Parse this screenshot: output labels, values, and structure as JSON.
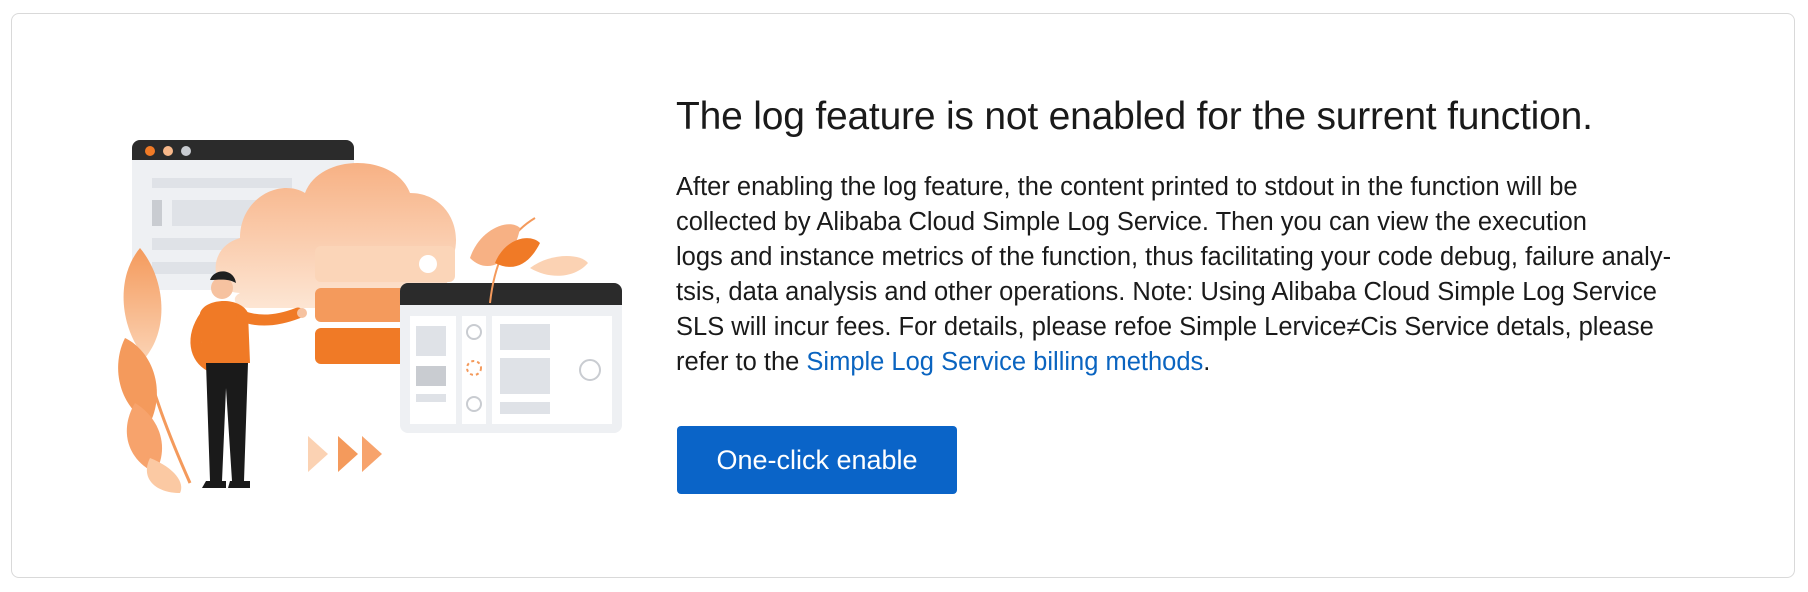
{
  "panel": {
    "title": "The log feature is not enabled for the surrent function.",
    "description_lines": [
      "After enabling the log feature, the content printed to stdout in the function will be",
      "collected by Alibaba Cloud Simple Log Service. Then you can view the execution",
      "logs and instance metrics of the function, thus facilitating your code debug, failure analy-",
      "tsis, data analysis and other operations. Note: Using Alibaba Cloud Simple Log Service",
      "SLS will incur fees. For details, please refoe Simple Lervice≠Cis Service detals, please",
      "refer to the "
    ],
    "billing_link": "Simple Log Service billing methods",
    "trailing_period": ".",
    "enable_button": "One-click enable"
  },
  "illustration": {
    "icons": [
      "browser-window-icon",
      "cloud-icon",
      "server-stack-icon",
      "person-icon",
      "dashboard-window-icon",
      "leaf-icon",
      "arrow-icon"
    ],
    "colors": {
      "orange": "#f07a26",
      "light_orange": "#f8b88a",
      "pale_orange": "#fde3cf",
      "dark": "#2b2b2b",
      "gray": "#e8eaee",
      "blue": "#0a64c8"
    }
  }
}
